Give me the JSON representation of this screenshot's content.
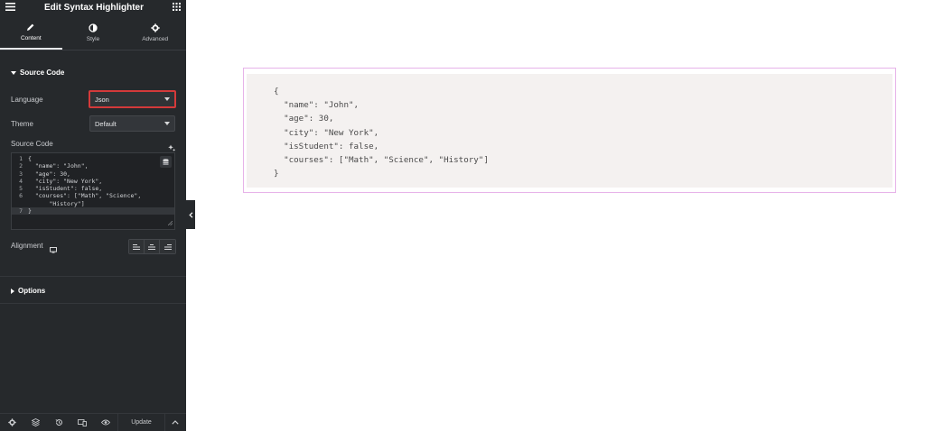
{
  "header": {
    "title": "Edit Syntax Highlighter",
    "menu_icon": "hamburger-icon",
    "grid_icon": "grid-icon"
  },
  "tabs": [
    {
      "label": "Content",
      "icon": "pencil-icon",
      "active": true
    },
    {
      "label": "Style",
      "icon": "half-circle-icon",
      "active": false
    },
    {
      "label": "Advanced",
      "icon": "gear-icon",
      "active": false
    }
  ],
  "section_source": {
    "title": "Source Code"
  },
  "language": {
    "label": "Language",
    "value": "Json"
  },
  "theme": {
    "label": "Theme",
    "value": "Default"
  },
  "source_code": {
    "label": "Source Code",
    "lines": [
      {
        "num": "1",
        "text": "{"
      },
      {
        "num": "2",
        "text": "  \"name\": \"John\","
      },
      {
        "num": "3",
        "text": "  \"age\": 30,"
      },
      {
        "num": "4",
        "text": "  \"city\": \"New York\","
      },
      {
        "num": "5",
        "text": "  \"isStudent\": false,"
      },
      {
        "num": "6",
        "text": "  \"courses\": [\"Math\", \"Science\","
      },
      {
        "num": "",
        "text": "      \"History\"]"
      },
      {
        "num": "7",
        "text": "}"
      }
    ]
  },
  "alignment": {
    "label": "Alignment"
  },
  "section_options": {
    "title": "Options"
  },
  "footer": {
    "update_label": "Update"
  },
  "preview": {
    "lines": [
      "{",
      "  \"name\": \"John\",",
      "  \"age\": 30,",
      "  \"city\": \"New York\",",
      "  \"isStudent\": false,",
      "  \"courses\": [\"Math\", \"Science\", \"History\"]",
      "}"
    ]
  },
  "colors": {
    "panel_bg": "#26292c",
    "highlight_border": "#d43a3a",
    "preview_border": "#e7b3e9",
    "preview_bg": "#f4f1f0"
  }
}
